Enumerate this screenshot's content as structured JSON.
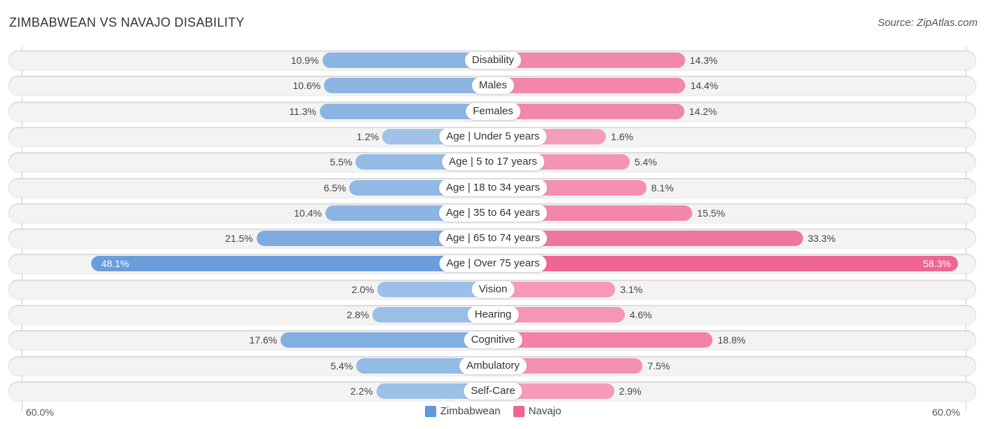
{
  "header": {
    "title": "ZIMBABWEAN VS NAVAJO DISABILITY",
    "source": "Source: ZipAtlas.com"
  },
  "colors": {
    "zimbabwean": "#6399d8",
    "zimbabwean_light": "#aac9ec",
    "navajo": "#f06592",
    "navajo_light": "#f6a9c1"
  },
  "chart_data": {
    "type": "bar",
    "orientation": "horizontal-diverging",
    "title": "ZIMBABWEAN VS NAVAJO DISABILITY",
    "xlabel": "",
    "ylabel": "",
    "xlim": [
      -60,
      60
    ],
    "axis_labels": {
      "left": "60.0%",
      "right": "60.0%"
    },
    "legend_position": "bottom-center",
    "categories": [
      "Disability",
      "Males",
      "Females",
      "Age | Under 5 years",
      "Age | 5 to 17 years",
      "Age | 18 to 34 years",
      "Age | 35 to 64 years",
      "Age | 65 to 74 years",
      "Age | Over 75 years",
      "Vision",
      "Hearing",
      "Cognitive",
      "Ambulatory",
      "Self-Care"
    ],
    "series": [
      {
        "name": "Zimbabwean",
        "values": [
          10.9,
          10.6,
          11.3,
          1.2,
          5.5,
          6.5,
          10.4,
          21.5,
          48.1,
          2.0,
          2.8,
          17.6,
          5.4,
          2.2
        ],
        "labels": [
          "10.9%",
          "10.6%",
          "11.3%",
          "1.2%",
          "5.5%",
          "6.5%",
          "10.4%",
          "21.5%",
          "48.1%",
          "2.0%",
          "2.8%",
          "17.6%",
          "5.4%",
          "2.2%"
        ]
      },
      {
        "name": "Navajo",
        "values": [
          14.3,
          14.4,
          14.2,
          1.6,
          5.4,
          8.1,
          15.5,
          33.3,
          58.3,
          3.1,
          4.6,
          18.8,
          7.5,
          2.9
        ],
        "labels": [
          "14.3%",
          "14.4%",
          "14.2%",
          "1.6%",
          "5.4%",
          "8.1%",
          "15.5%",
          "33.3%",
          "58.3%",
          "3.1%",
          "4.6%",
          "18.8%",
          "7.5%",
          "2.9%"
        ]
      }
    ]
  }
}
